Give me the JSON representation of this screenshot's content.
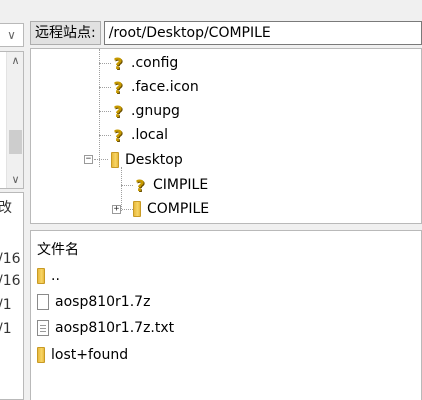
{
  "left_pane": {
    "list_header_fragment": "改",
    "list_rows": [
      "/16",
      "/16",
      "/1",
      "/1"
    ]
  },
  "remote": {
    "site_label": "远程站点:",
    "site_path": "/root/Desktop/COMPILE",
    "tree": [
      {
        "label": ".config",
        "icon": "question-icon"
      },
      {
        "label": ".face.icon",
        "icon": "question-icon"
      },
      {
        "label": ".gnupg",
        "icon": "question-icon"
      },
      {
        "label": ".local",
        "icon": "question-icon"
      },
      {
        "label": "Desktop",
        "icon": "folder-icon"
      },
      {
        "label": "CIMPILE",
        "icon": "question-icon"
      },
      {
        "label": "COMPILE",
        "icon": "folder-icon"
      }
    ],
    "list_header": "文件名",
    "files": [
      {
        "label": "..",
        "icon": "folder-icon"
      },
      {
        "label": "aosp810r1.7z",
        "icon": "file-icon"
      },
      {
        "label": "aosp810r1.7z.txt",
        "icon": "text-file-icon"
      },
      {
        "label": "lost+found",
        "icon": "folder-icon"
      }
    ]
  }
}
